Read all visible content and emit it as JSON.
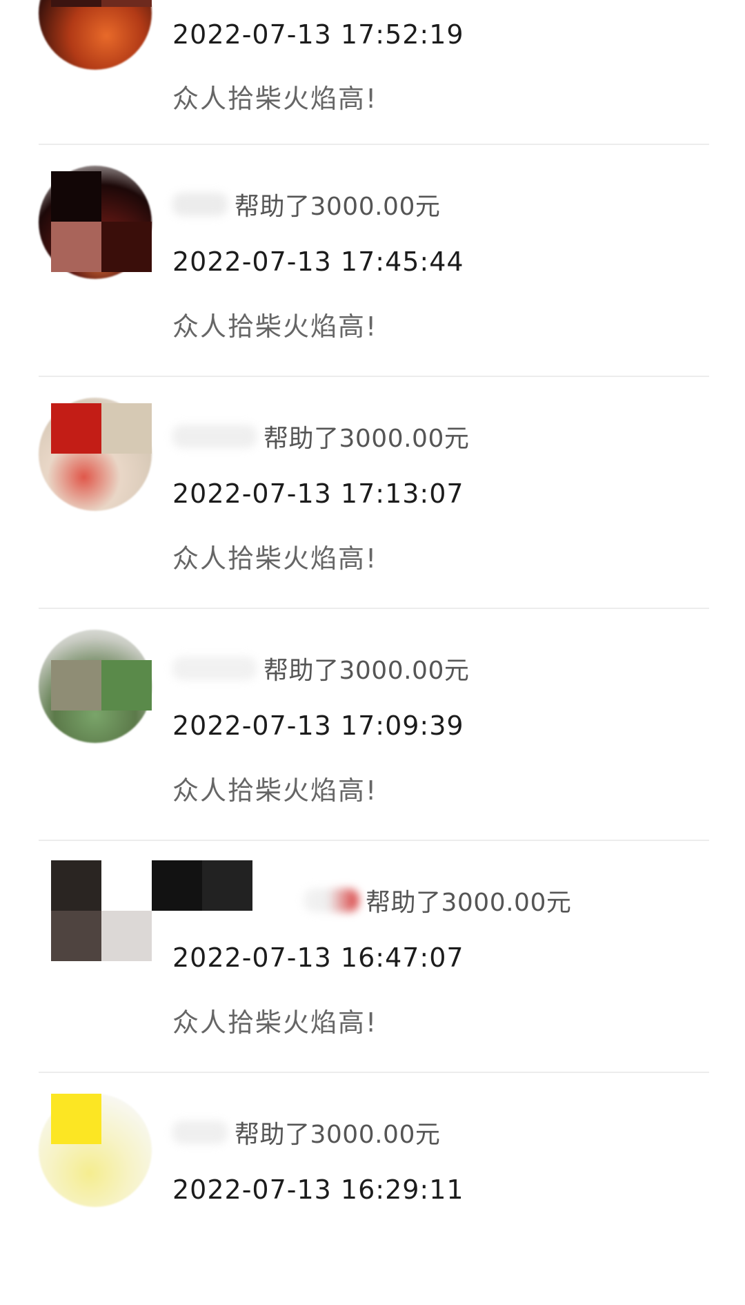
{
  "donations": [
    {
      "amount_text": "",
      "time": "2022-07-13 17:52:19",
      "message": "众人拾柴火焰高!"
    },
    {
      "amount_text": "帮助了3000.00元",
      "time": "2022-07-13 17:45:44",
      "message": "众人拾柴火焰高!"
    },
    {
      "amount_text": "帮助了3000.00元",
      "time": "2022-07-13 17:13:07",
      "message": "众人拾柴火焰高!"
    },
    {
      "amount_text": "帮助了3000.00元",
      "time": "2022-07-13 17:09:39",
      "message": "众人拾柴火焰高!"
    },
    {
      "amount_text": "帮助了3000.00元",
      "time": "2022-07-13 16:47:07",
      "message": "众人拾柴火焰高!"
    },
    {
      "amount_text": "帮助了3000.00元",
      "time": "2022-07-13 16:29:11",
      "message": ""
    }
  ],
  "colors": {
    "divider": "#ececec",
    "amount_text": "#555555",
    "message_text": "#666666",
    "time_text": "#1c1c1c"
  }
}
